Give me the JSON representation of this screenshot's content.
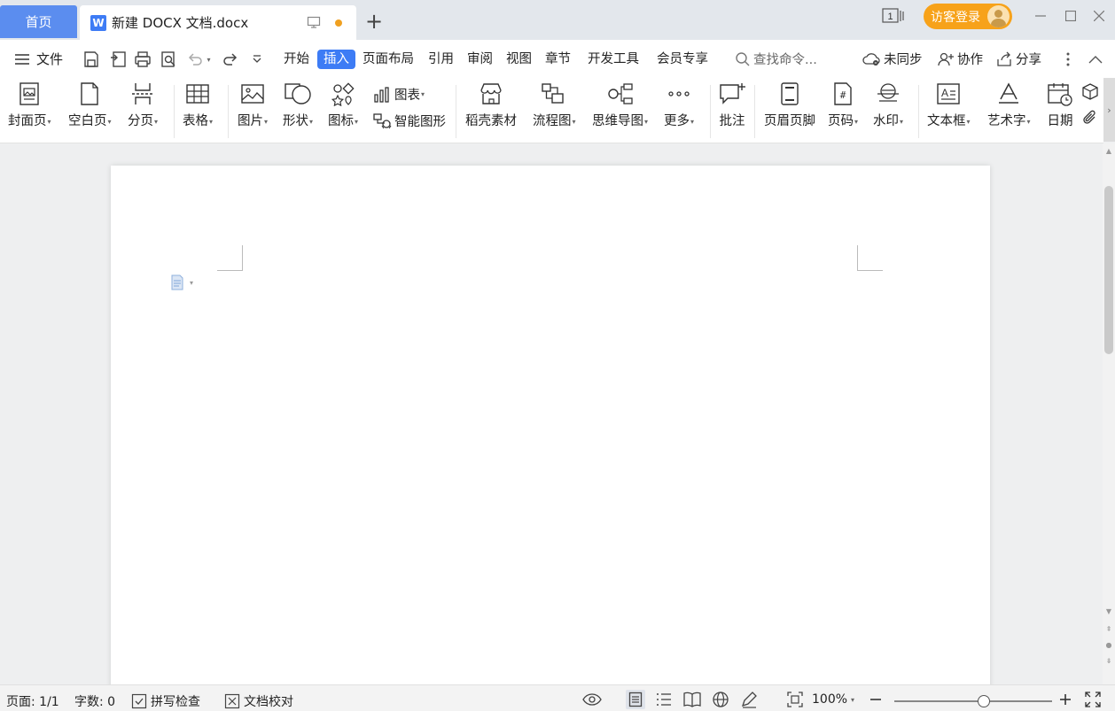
{
  "titlebar": {
    "home_tab": "首页",
    "doc_tab_title": "新建 DOCX 文档.docx",
    "doc_icon_letter": "W",
    "window_count": "1",
    "login_label": "访客登录"
  },
  "menubar": {
    "file_label": "文件",
    "items": [
      "开始",
      "插入",
      "页面布局",
      "引用",
      "审阅",
      "视图",
      "章节",
      "开发工具",
      "会员专享"
    ],
    "active_item": "插入",
    "search_placeholder": "查找命令...",
    "sync_label": "未同步",
    "collab_label": "协作",
    "share_label": "分享"
  },
  "ribbon": {
    "cover": "封面页",
    "blank": "空白页",
    "pagebreak": "分页",
    "table": "表格",
    "picture": "图片",
    "shape": "形状",
    "icon": "图标",
    "chart": "图表",
    "smartart": "智能图形",
    "material": "稻壳素材",
    "flowchart": "流程图",
    "mindmap": "思维导图",
    "more": "更多",
    "comment": "批注",
    "header_footer": "页眉页脚",
    "page_number": "页码",
    "watermark": "水印",
    "textbox": "文本框",
    "wordart": "艺术字",
    "date": "日期"
  },
  "status": {
    "page": "页面: 1/1",
    "words": "字数: 0",
    "spellcheck": "拼写检查",
    "proofread": "文档校对",
    "zoom": "100%",
    "zoom_fraction": 0.5
  },
  "colors": {
    "accent": "#3d7cf5",
    "home_tab": "#5b8def",
    "login": "#f7a21a",
    "unsaved_dot": "#f0a020"
  }
}
